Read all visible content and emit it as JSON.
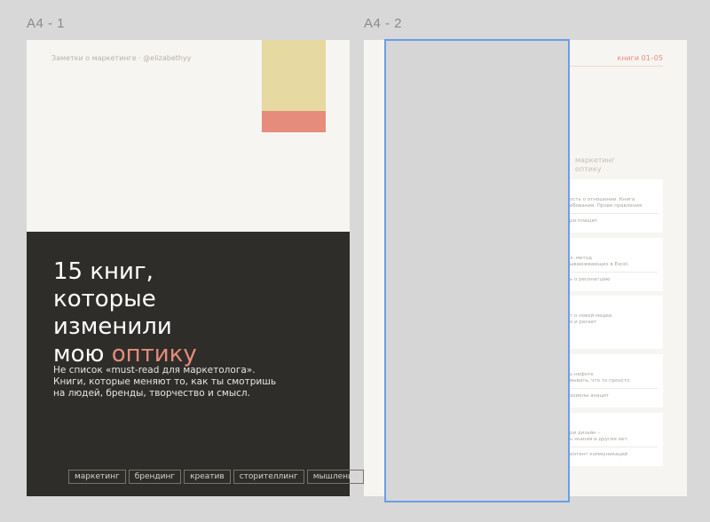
{
  "frames": {
    "frame1_label": "A4 - 1",
    "frame2_label": "A4 - 2"
  },
  "page1": {
    "top_credit": "Заметки о маркетинге · @elizabethyy",
    "title_line1": "15 книг,",
    "title_line2": "которые",
    "title_line3": "изменили",
    "title_line4_main": "мою ",
    "title_line4_accent": "оптику",
    "subtitle_line1": "Не список «must-read для маркетолога».",
    "subtitle_line2": "Книги, которые меняют то, как ты смотришь",
    "subtitle_line3": "на людей, бренды, творчество и смысл.",
    "tags": [
      "маркетинг",
      "брендинг",
      "креатив",
      "сторителлинг",
      "мышление"
    ]
  },
  "page2": {
    "top_right": "книги 01–05",
    "section_title_line1": "маркетинг",
    "section_title_line2": "оптику",
    "cards": [
      {
        "l1": "ость о отношении. Книга",
        "l2": "ебования. Прове  правления",
        "l3": "ри плащит"
      },
      {
        "l1": "л. метод",
        "l2": "ываюжвающих в Excel.",
        "l3": "ь о ресонатцию"
      },
      {
        "l1": "т о новой медиа",
        "l2": "о и ресеет",
        "l3": ""
      },
      {
        "l1": "ь нефоте",
        "l2": "вывать, что то проосто",
        "l3": "ахиелы анацит"
      },
      {
        "l1": "ри дизайн –",
        "l2": "ь знания и другие нет.",
        "l3": "интент коммуникаций"
      }
    ]
  },
  "colors": {
    "accent": "#e58c7c",
    "yellow_block": "#e6d9a1",
    "dark_panel": "#2f2d2a",
    "selection_border": "#6a9ee9"
  }
}
